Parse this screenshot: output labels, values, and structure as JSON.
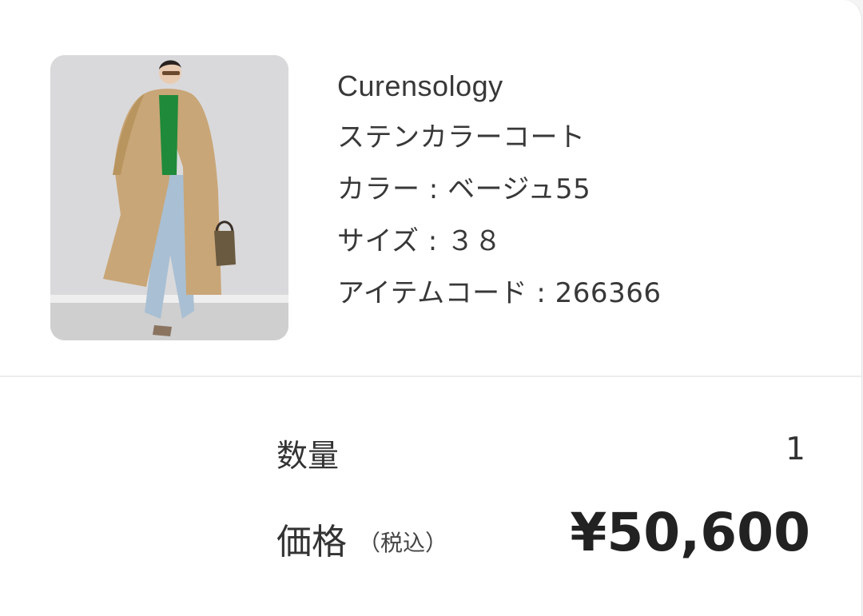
{
  "product": {
    "brand": "Curensology",
    "name": "ステンカラーコート",
    "color": "カラー : ベージュ55",
    "size": "サイズ : ３８",
    "item_code": "アイテムコード : 266366",
    "image": {
      "description": "product-photo",
      "colors": {
        "background": "#dcdcdc",
        "coat": "#c9a677",
        "sweater": "#1f8a3a",
        "jeans": "#a9bfd3"
      }
    }
  },
  "summary": {
    "quantity_label": "数量",
    "quantity_value": "1",
    "price_label": "価格",
    "tax_note": "（税込）",
    "price_value": "¥50,600"
  }
}
